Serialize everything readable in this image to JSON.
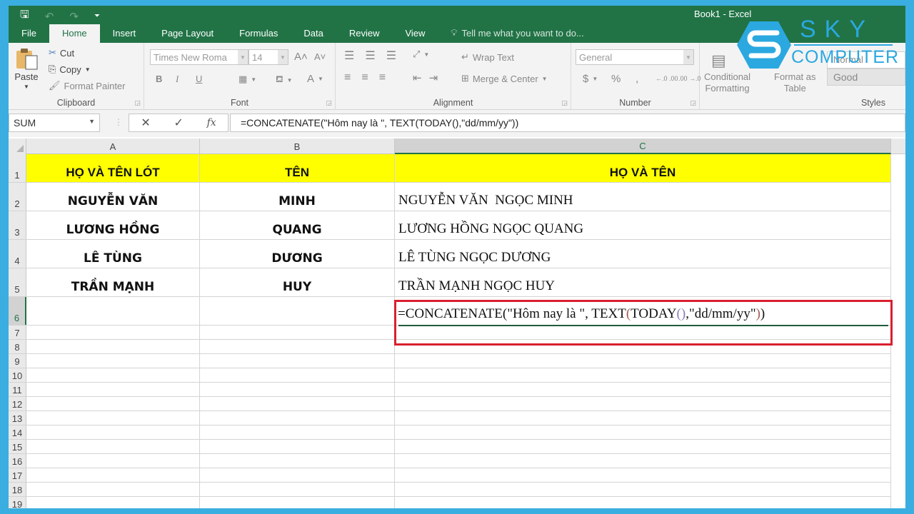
{
  "window": {
    "title": "Book1 - Excel",
    "qat": [
      {
        "icon": "save-icon",
        "glyph": "🖫"
      },
      {
        "icon": "undo-icon",
        "glyph": "↶"
      },
      {
        "icon": "redo-icon",
        "glyph": "↷"
      },
      {
        "icon": "customize-qat-icon",
        "glyph": "⏷"
      }
    ]
  },
  "tabs": [
    {
      "label": "File"
    },
    {
      "label": "Home",
      "active": true
    },
    {
      "label": "Insert"
    },
    {
      "label": "Page Layout"
    },
    {
      "label": "Formulas"
    },
    {
      "label": "Data"
    },
    {
      "label": "Review"
    },
    {
      "label": "View"
    }
  ],
  "tell_me": {
    "icon": "lightbulb-icon",
    "placeholder": "Tell me what you want to do..."
  },
  "ribbon": {
    "clipboard": {
      "label": "Clipboard",
      "paste": "Paste",
      "cut": "Cut",
      "copy": "Copy",
      "format_painter": "Format Painter"
    },
    "font": {
      "label": "Font",
      "font_name": "Times New Roma",
      "font_size": "14",
      "bold": "B",
      "italic": "I",
      "underline": "U",
      "grow": "A˄",
      "shrink": "A˅",
      "font_color": "A"
    },
    "alignment": {
      "label": "Alignment",
      "wrap_text": "Wrap Text",
      "merge_center": "Merge & Center"
    },
    "number": {
      "label": "Number",
      "format": "General",
      "currency": "$",
      "percent": "%",
      "comma": ",",
      "inc_decimal": "←.0 .00",
      "dec_decimal": ".00 →.0"
    },
    "styles": {
      "label": "Styles",
      "conditional_formatting": [
        "Conditional",
        "Formatting"
      ],
      "format_as_table": [
        "Format as",
        "Table"
      ],
      "style_normal": "Normal",
      "style_good": "Good"
    }
  },
  "watermark": {
    "line1": "SKY",
    "line2": "COMPUTER",
    "color": "#2ba8e0"
  },
  "formula_bar": {
    "name_box": "SUM",
    "cancel": "✕",
    "enter": "✓",
    "fx": "fx",
    "formula": "=CONCATENATE(\"Hôm nay là \", TEXT(TODAY(),\"dd/mm/yy\"))"
  },
  "sheet": {
    "columns": [
      "A",
      "B",
      "C"
    ],
    "selected_column": "C",
    "selected_row": 6,
    "header_fill": "#ffff00",
    "edit_border_color": "#d9202e",
    "header_row": [
      "HỌ VÀ TÊN LÓT",
      "TÊN",
      "HỌ VÀ TÊN"
    ],
    "rows": [
      [
        "NGUYỄN VĂN",
        "MINH",
        "NGUYỄN VĂN  NGỌC MINH"
      ],
      [
        "LƯƠNG HỒNG",
        "QUANG",
        "LƯƠNG HỒNG NGỌC QUANG"
      ],
      [
        "LÊ TÙNG",
        "DƯƠNG",
        "LÊ TÙNG NGỌC DƯƠNG"
      ],
      [
        "TRẦN MẠNH",
        "HUY",
        "TRẦN MẠNH NGỌC HUY"
      ]
    ],
    "editing_cell": {
      "ref": "C6",
      "parts": [
        "=CONCATENATE(\"Hôm nay là \", TEXT",
        "(",
        "TODAY",
        "()",
        ",\"dd/mm/yy\"",
        ")",
        ")"
      ]
    },
    "row_numbers": [
      "1",
      "2",
      "3",
      "4",
      "5",
      "6",
      "7",
      "8",
      "9",
      "10",
      "11",
      "12",
      "13",
      "14",
      "15",
      "16",
      "17",
      "18",
      "19"
    ]
  }
}
